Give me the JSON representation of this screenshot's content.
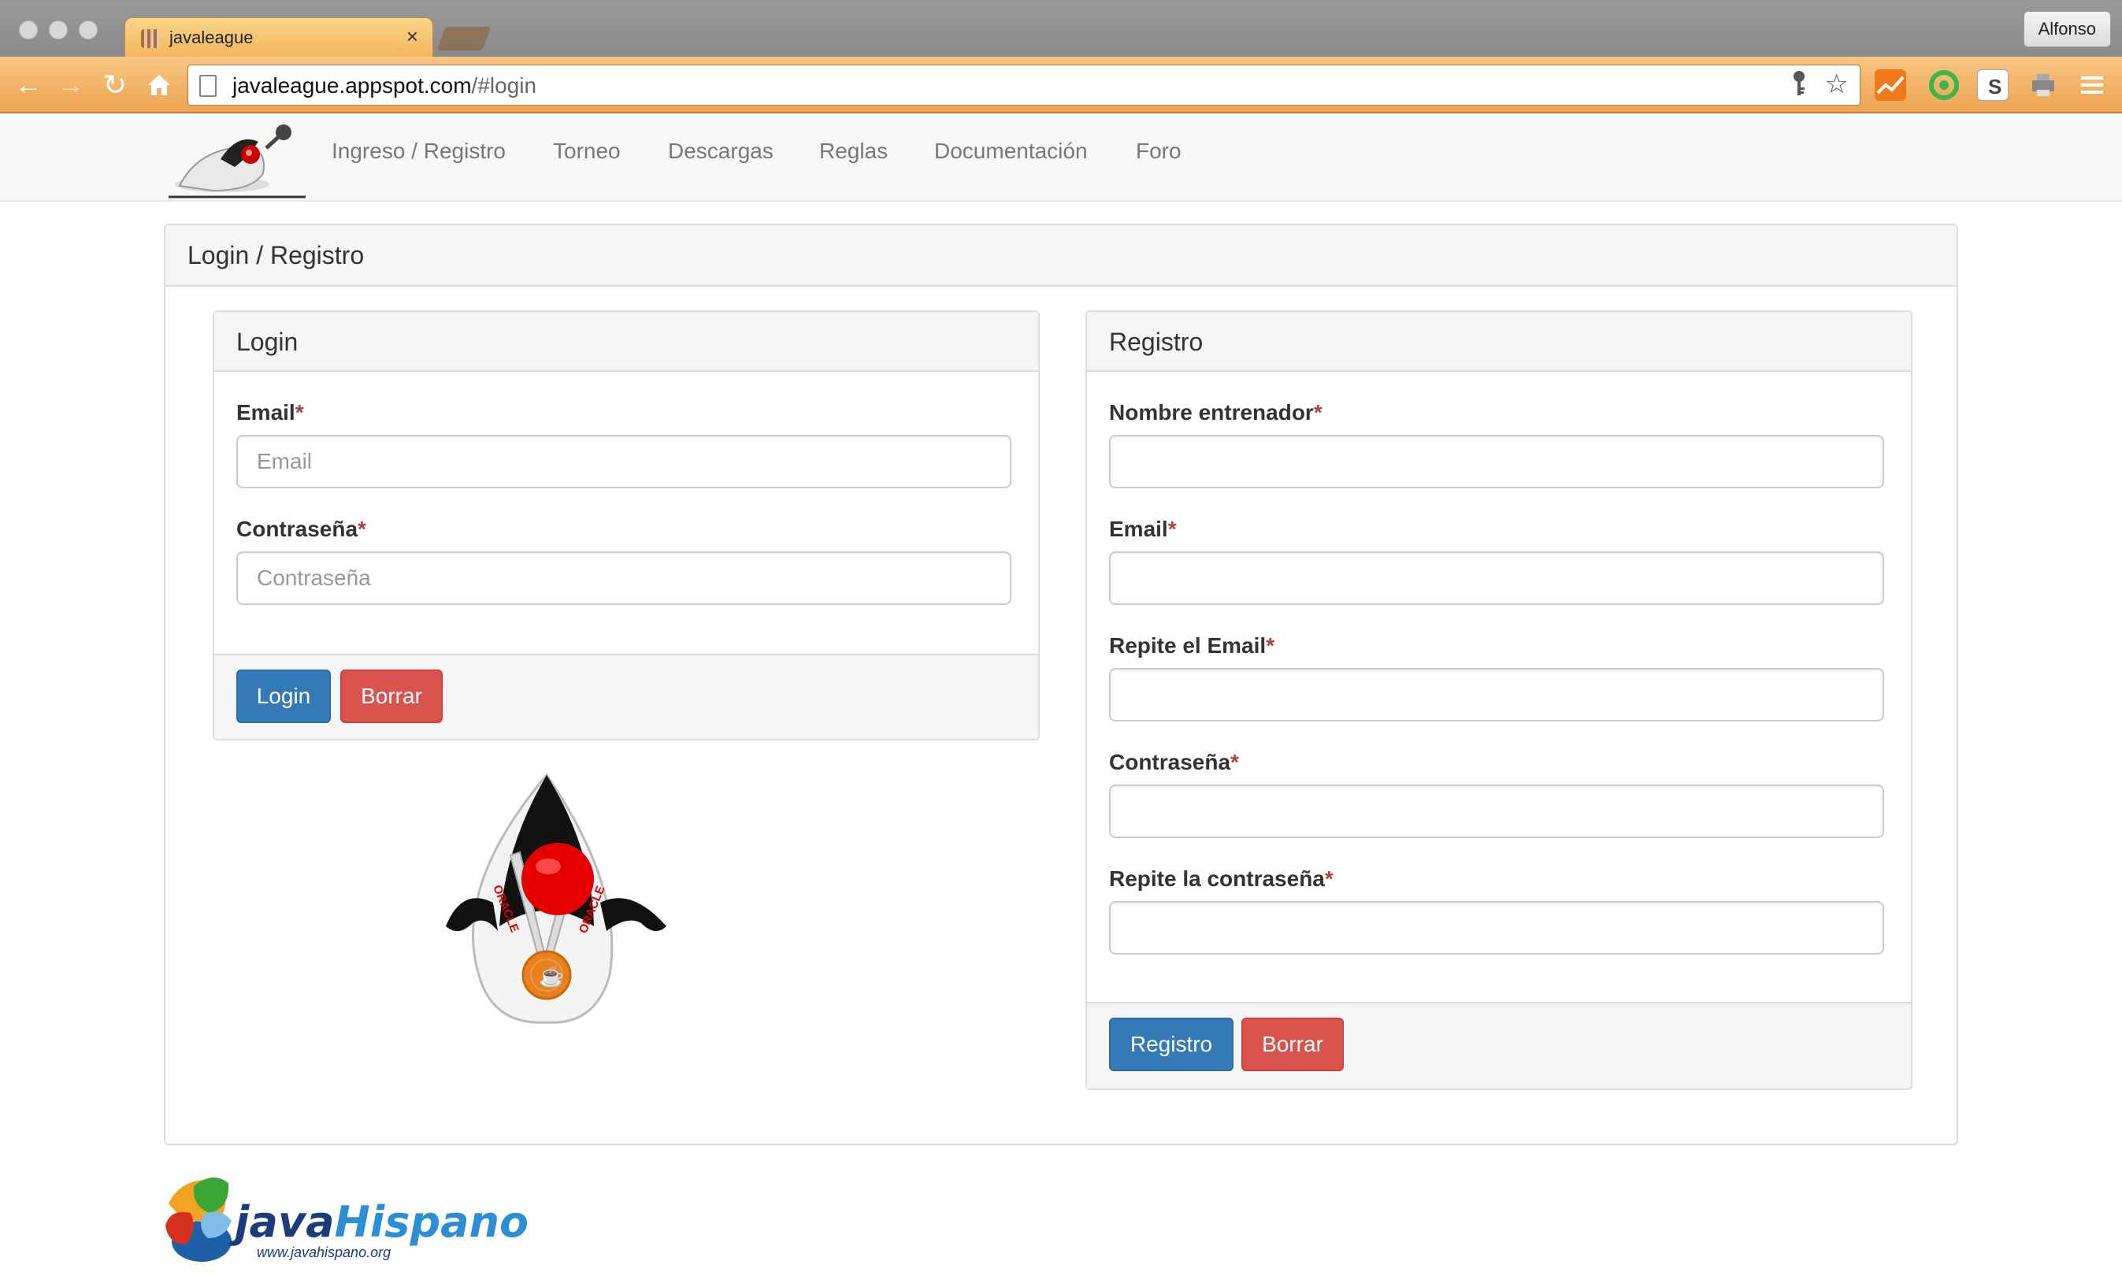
{
  "browser": {
    "tab_title": "javaleague",
    "tab_close": "×",
    "profile_name": "Alfonso",
    "url_host": "javaleague.appspot.com",
    "url_path": "/#login",
    "nav_icons": [
      "back-arrow-icon",
      "forward-arrow-icon",
      "reload-icon",
      "home-icon"
    ],
    "extension_icons": [
      "chart-extension-icon",
      "green-circle-extension-icon",
      "s-extension-icon",
      "printer-extension-icon",
      "menu-icon"
    ],
    "accent_color": "#eea350"
  },
  "navbar": {
    "links": [
      "Ingreso / Registro",
      "Torneo",
      "Descargas",
      "Reglas",
      "Documentación",
      "Foro"
    ]
  },
  "main": {
    "title": "Login / Registro",
    "login": {
      "title": "Login",
      "email_label": "Email",
      "email_placeholder": "Email",
      "password_label": "Contraseña",
      "password_placeholder": "Contraseña",
      "submit_label": "Login",
      "reset_label": "Borrar"
    },
    "register": {
      "title": "Registro",
      "fields": [
        {
          "label": "Nombre entrenador"
        },
        {
          "label": "Email"
        },
        {
          "label": "Repite el Email"
        },
        {
          "label": "Contraseña"
        },
        {
          "label": "Repite la contraseña"
        }
      ],
      "submit_label": "Registro",
      "reset_label": "Borrar"
    },
    "required_mark": "*"
  },
  "mascot": {
    "badge_text": "ORACLE"
  },
  "footer": {
    "logo_text": "javaHispano",
    "logo_url_text": "www.javahispano.org"
  },
  "colors": {
    "primary": "#337ab7",
    "danger": "#d9534f",
    "required": "#a94442"
  }
}
